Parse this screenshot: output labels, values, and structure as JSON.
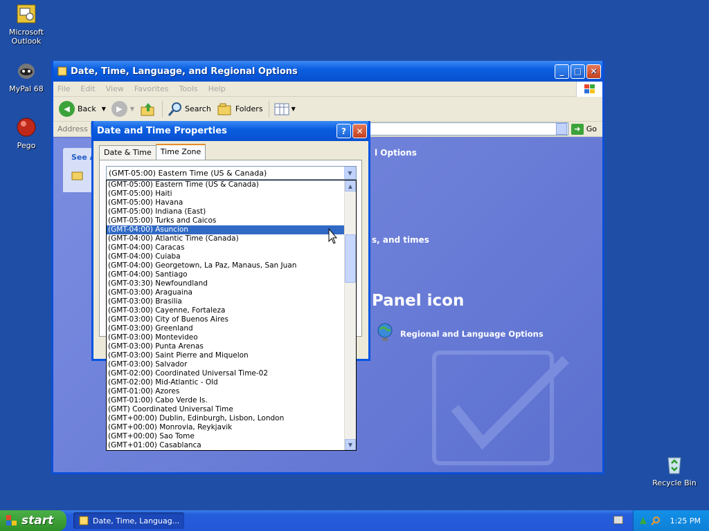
{
  "desktop": {
    "icons": [
      {
        "label": "Microsoft Outlook"
      },
      {
        "label": "MyPal 68"
      },
      {
        "label": "Pego"
      },
      {
        "label": "Recycle Bin"
      }
    ]
  },
  "explorer": {
    "title": "Date, Time, Language, and Regional Options",
    "menu": [
      "File",
      "Edit",
      "View",
      "Favorites",
      "Tools",
      "Help"
    ],
    "toolbar": {
      "back": "Back",
      "search": "Search",
      "folders": "Folders"
    },
    "address_label": "Address",
    "go_label": "Go",
    "see_also_header": "See A",
    "content": {
      "options_title": "l Options",
      "times_title": "s, and times",
      "panel_icon_title": "Panel icon",
      "regional_link": "Regional and Language Options"
    }
  },
  "dialog": {
    "title": "Date and Time Properties",
    "tabs": [
      "Date & Time",
      "Time Zone"
    ],
    "active_tab": "Time Zone",
    "selected_timezone": "(GMT-05:00) Eastern Time (US & Canada)",
    "timezones": [
      "(GMT-05:00) Eastern Time (US & Canada)",
      "(GMT-05:00) Haiti",
      "(GMT-05:00) Havana",
      "(GMT-05:00) Indiana (East)",
      "(GMT-05:00) Turks and Caicos",
      "(GMT-04:00) Asuncion",
      "(GMT-04:00) Atlantic Time (Canada)",
      "(GMT-04:00) Caracas",
      "(GMT-04:00) Cuiaba",
      "(GMT-04:00) Georgetown, La Paz, Manaus, San Juan",
      "(GMT-04:00) Santiago",
      "(GMT-03:30) Newfoundland",
      "(GMT-03:00) Araguaina",
      "(GMT-03:00) Brasilia",
      "(GMT-03:00) Cayenne, Fortaleza",
      "(GMT-03:00) City of Buenos Aires",
      "(GMT-03:00) Greenland",
      "(GMT-03:00) Montevideo",
      "(GMT-03:00) Punta Arenas",
      "(GMT-03:00) Saint Pierre and Miquelon",
      "(GMT-03:00) Salvador",
      "(GMT-02:00) Coordinated Universal Time-02",
      "(GMT-02:00) Mid-Atlantic - Old",
      "(GMT-01:00) Azores",
      "(GMT-01:00) Cabo Verde Is.",
      "(GMT) Coordinated Universal Time",
      "(GMT+00:00) Dublin, Edinburgh, Lisbon, London",
      "(GMT+00:00) Monrovia, Reykjavik",
      "(GMT+00:00) Sao Tome",
      "(GMT+01:00) Casablanca"
    ],
    "highlighted_index": 5
  },
  "taskbar": {
    "start_label": "start",
    "task_label": "Date, Time, Languag...",
    "clock": "1:25 PM"
  },
  "colors": {
    "desktop": "#1f4ea6",
    "selection": "#316ac5",
    "titlebar": "#0a5ee0"
  }
}
